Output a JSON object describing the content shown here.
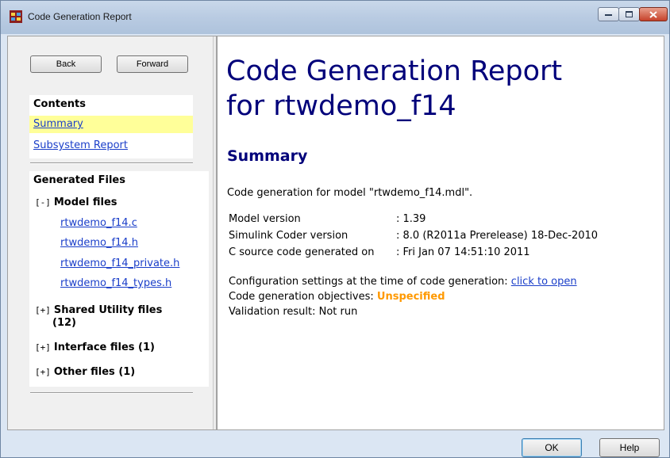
{
  "window": {
    "title": "Code Generation Report"
  },
  "nav": {
    "back": "Back",
    "forward": "Forward"
  },
  "contents": {
    "heading": "Contents",
    "summary": "Summary",
    "subsystem_report": "Subsystem Report"
  },
  "generated_files": {
    "heading": "Generated Files",
    "groups": [
      {
        "toggle": "[-]",
        "label": "Model files"
      },
      {
        "toggle": "[+]",
        "label": "Shared Utility files",
        "label2": "(12)"
      },
      {
        "toggle": "[+]",
        "label": "Interface files (1)"
      },
      {
        "toggle": "[+]",
        "label": "Other files (1)"
      }
    ],
    "model_files": [
      "rtwdemo_f14.c",
      "rtwdemo_f14.h",
      "rtwdemo_f14_private.h",
      "rtwdemo_f14_types.h"
    ]
  },
  "report": {
    "title_line1": "Code Generation Report",
    "title_line2": "for rtwdemo_f14",
    "section": "Summary",
    "intro": "Code generation for model \"rtwdemo_f14.mdl\".",
    "rows": [
      {
        "label": "Model version",
        "value": ": 1.39"
      },
      {
        "label": "Simulink Coder version",
        "value": ": 8.0 (R2011a Prerelease) 18-Dec-2010"
      },
      {
        "label": "C source code generated on",
        "value": ": Fri Jan 07 14:51:10 2011"
      }
    ],
    "config_text": "Configuration settings at the time of code generation: ",
    "config_link": "click to open",
    "objectives_text": "Code generation objectives: ",
    "objectives_value": "Unspecified",
    "validation": "Validation result: Not run"
  },
  "buttons": {
    "ok": "OK",
    "help": "Help"
  },
  "colors": {
    "heading": "#00007a",
    "link": "#1a3ec9",
    "highlight": "#ffff99",
    "objective": "#ff9900"
  }
}
